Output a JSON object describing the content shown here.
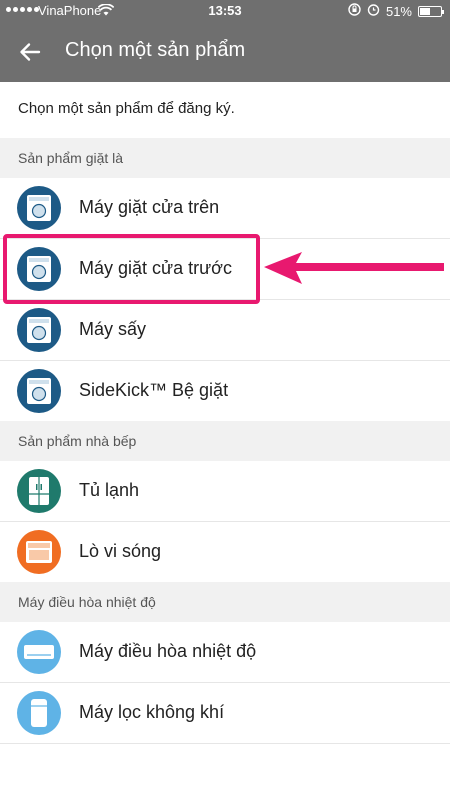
{
  "status_bar": {
    "carrier": "VinaPhone",
    "time": "13:53",
    "battery_text": "51%",
    "battery_level": 0.51
  },
  "app_bar": {
    "title": "Chọn một sản phẩm"
  },
  "intro": "Chọn một sản phẩm để đăng ký.",
  "sections": [
    {
      "header": "Sản phẩm giặt là",
      "items": [
        {
          "label": "Máy giặt cửa trên",
          "icon": "washer-icon",
          "color": "#1d5a86"
        },
        {
          "label": "Máy giặt cửa trước",
          "icon": "washer-icon",
          "color": "#1d5a86"
        },
        {
          "label": "Máy sấy",
          "icon": "dryer-icon",
          "color": "#1d5a86"
        },
        {
          "label": "SideKick™ Bệ giặt",
          "icon": "washer-icon",
          "color": "#1d5a86"
        }
      ]
    },
    {
      "header": "Sản phẩm nhà bếp",
      "items": [
        {
          "label": "Tủ lạnh",
          "icon": "refrigerator-icon",
          "color": "#1f7a6c"
        },
        {
          "label": "Lò vi sóng",
          "icon": "microwave-icon",
          "color": "#f06d22"
        }
      ]
    },
    {
      "header": "Máy điều hòa nhiệt độ",
      "items": [
        {
          "label": "Máy điều hòa nhiệt độ",
          "icon": "air-conditioner-icon",
          "color": "#5fb3e6"
        },
        {
          "label": "Máy lọc không khí",
          "icon": "air-purifier-icon",
          "color": "#5fb3e6"
        }
      ]
    }
  ],
  "annotation": {
    "color": "#e8196f"
  }
}
